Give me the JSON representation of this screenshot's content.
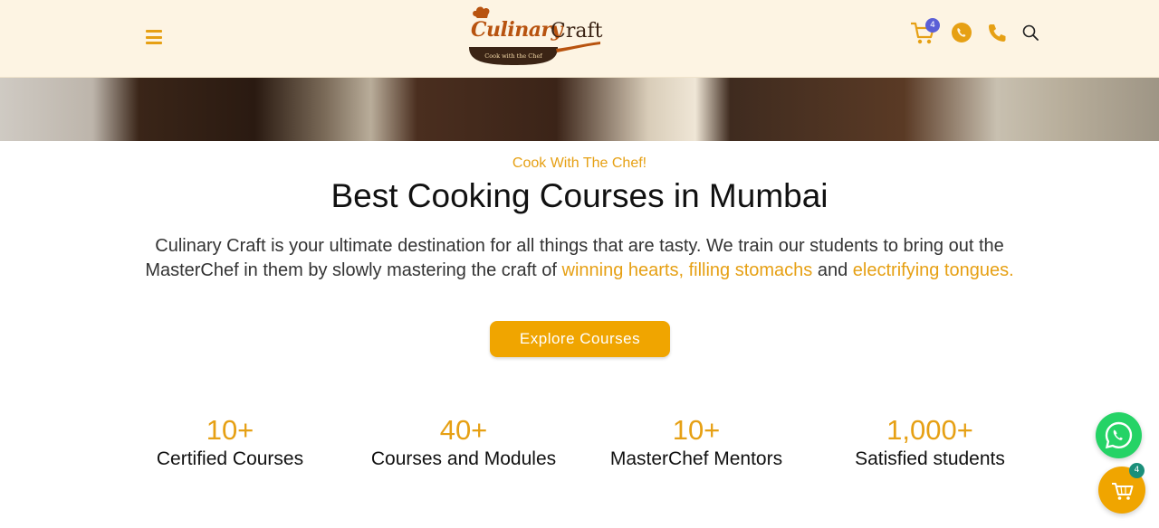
{
  "header": {
    "logo": {
      "script": "Culinary",
      "word": "Craft",
      "tagline": "Cook with the Chef"
    },
    "cart_count": "4",
    "icons": [
      "hamburger-icon",
      "cart-icon",
      "whatsapp-icon",
      "phone-icon",
      "search-icon"
    ]
  },
  "hero": {
    "eyebrow": "Cook With The Chef!",
    "title": "Best Cooking Courses in Mumbai",
    "desc_part1": "Culinary Craft is your ultimate destination for all things that are tasty. We train our students to bring out the MasterChef in them by slowly mastering the craft of ",
    "desc_hl1": "winning hearts, filling stomachs",
    "desc_part2": " and ",
    "desc_hl2": "electrifying tongues.",
    "cta": "Explore Courses"
  },
  "stats": [
    {
      "value": "10+",
      "label": "Certified Courses"
    },
    {
      "value": "40+",
      "label": "Courses and Modules"
    },
    {
      "value": "10+",
      "label": "MasterChef Mentors"
    },
    {
      "value": "1,000+",
      "label": "Satisfied students"
    }
  ],
  "floating": {
    "cart_count": "4"
  },
  "colors": {
    "accent": "#f0a500",
    "header_bg": "#fdf4e3",
    "whatsapp": "#25d366",
    "badge": "#5b5fd6"
  }
}
